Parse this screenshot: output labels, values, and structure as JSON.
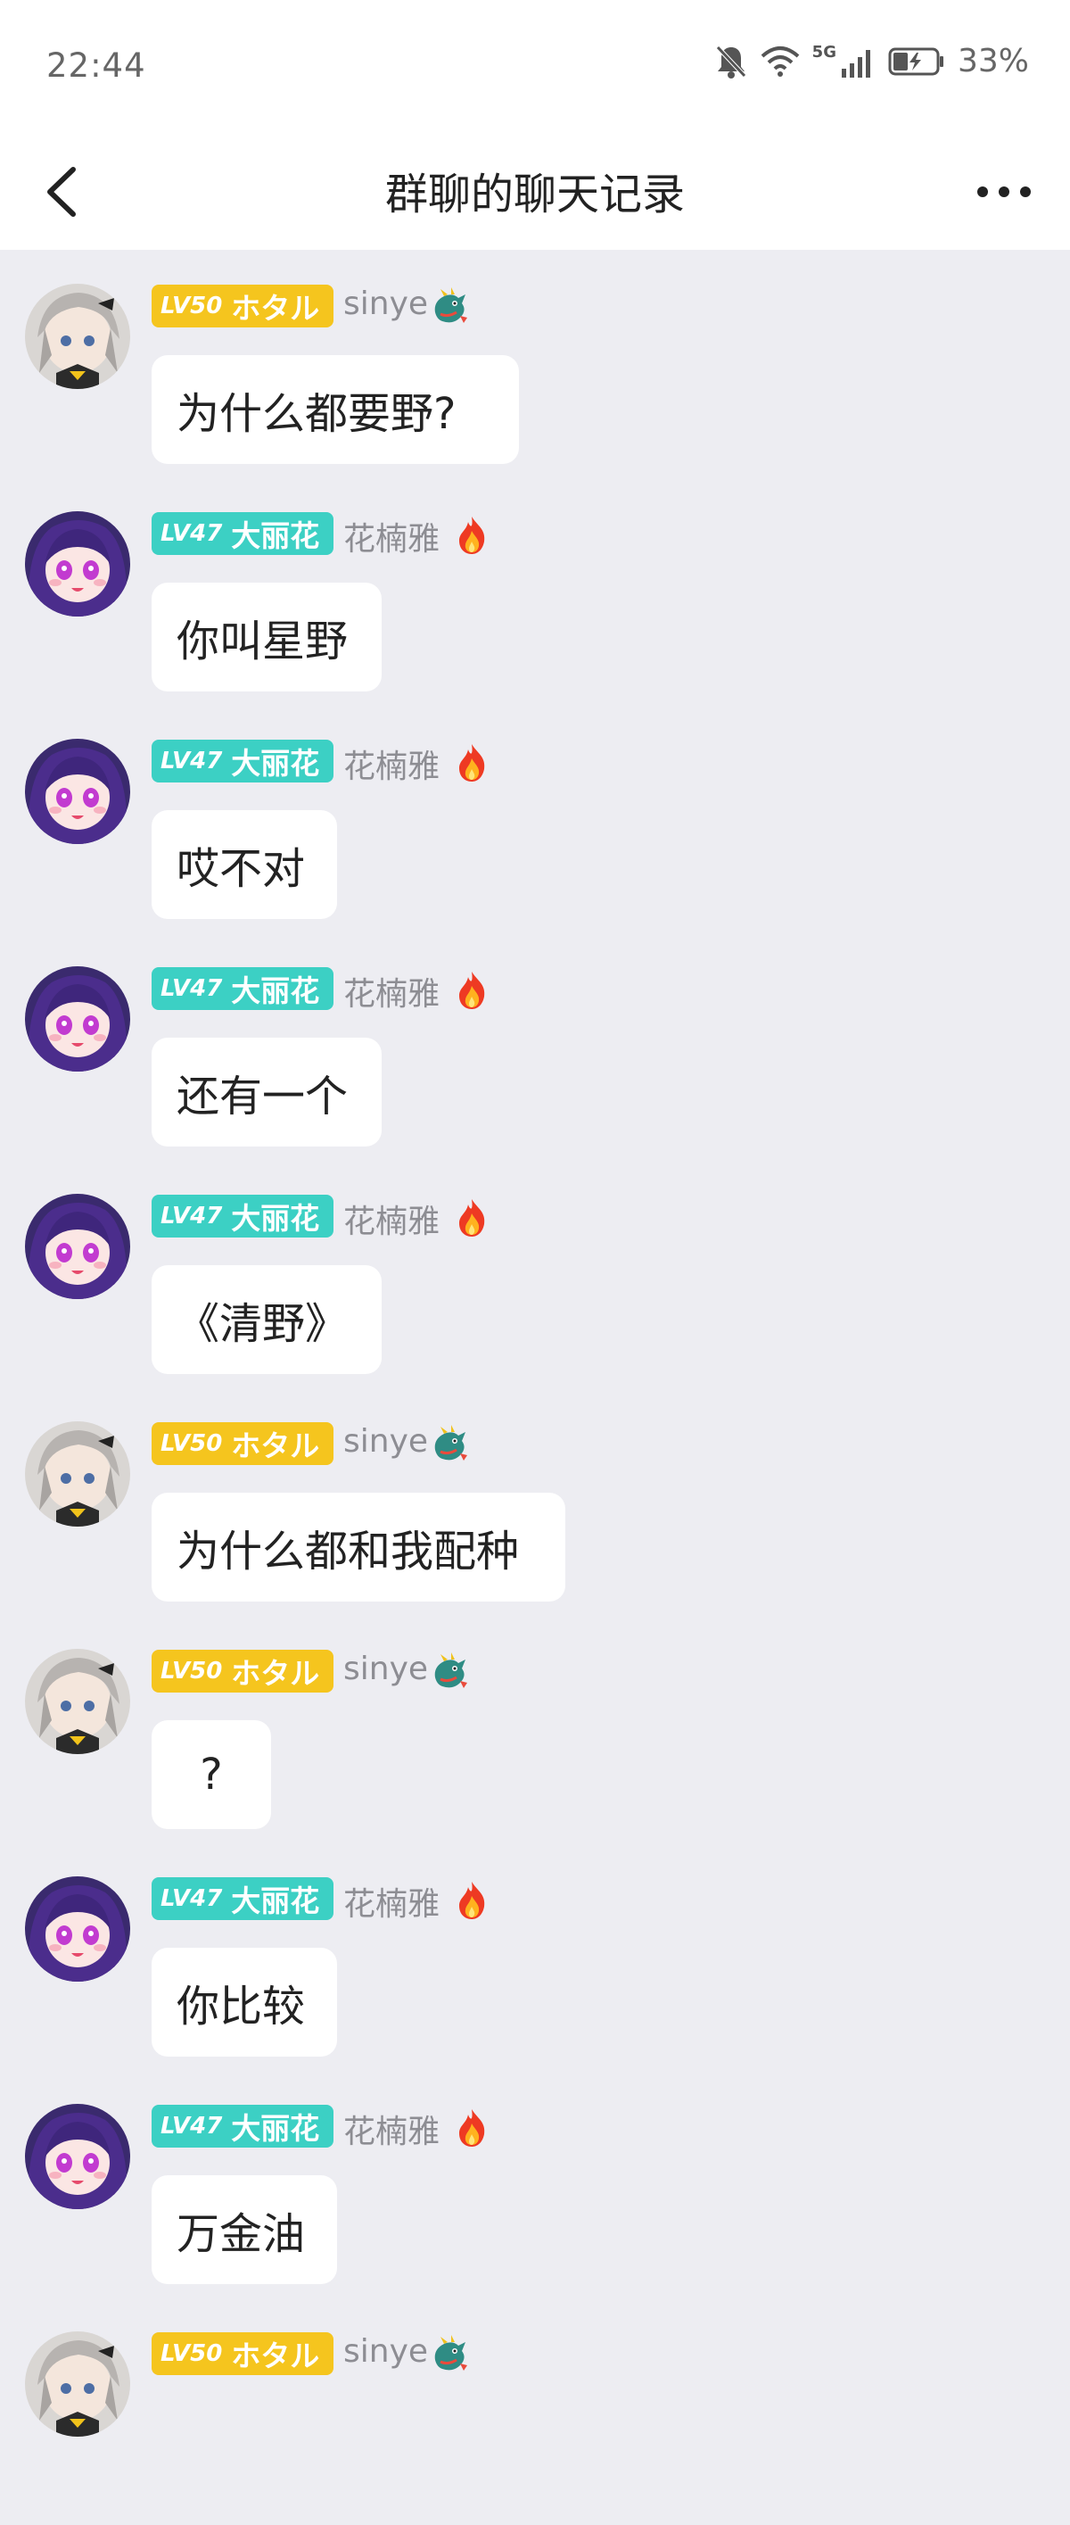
{
  "status_bar": {
    "time": "22:44",
    "network": "5G",
    "battery": "33%"
  },
  "header": {
    "title": "群聊的聊天记录"
  },
  "colors": {
    "gold_badge": "#f5c51e",
    "teal_badge": "#3cd0c4",
    "background": "#ededf2"
  },
  "messages": [
    {
      "level": "LV50",
      "tag": "ホタル",
      "name": "sinye",
      "text": "为什么都要野?",
      "badge": "gold",
      "emoji": "dragon-icon"
    },
    {
      "level": "LV47",
      "tag": "大丽花",
      "name": "花楠雅",
      "text": "你叫星野",
      "badge": "teal",
      "emoji": "fire-icon"
    },
    {
      "level": "LV47",
      "tag": "大丽花",
      "name": "花楠雅",
      "text": "哎不对",
      "badge": "teal",
      "emoji": "fire-icon"
    },
    {
      "level": "LV47",
      "tag": "大丽花",
      "name": "花楠雅",
      "text": "还有一个",
      "badge": "teal",
      "emoji": "fire-icon"
    },
    {
      "level": "LV47",
      "tag": "大丽花",
      "name": "花楠雅",
      "text": "《清野》",
      "badge": "teal",
      "emoji": "fire-icon"
    },
    {
      "level": "LV50",
      "tag": "ホタル",
      "name": "sinye",
      "text": "为什么都和我配种",
      "badge": "gold",
      "emoji": "dragon-icon"
    },
    {
      "level": "LV50",
      "tag": "ホタル",
      "name": "sinye",
      "text": "?",
      "badge": "gold",
      "emoji": "dragon-icon"
    },
    {
      "level": "LV47",
      "tag": "大丽花",
      "name": "花楠雅",
      "text": "你比较",
      "badge": "teal",
      "emoji": "fire-icon"
    },
    {
      "level": "LV47",
      "tag": "大丽花",
      "name": "花楠雅",
      "text": "万金油",
      "badge": "teal",
      "emoji": "fire-icon"
    },
    {
      "level": "LV50",
      "tag": "ホタル",
      "name": "sinye",
      "text": "",
      "badge": "gold",
      "emoji": "dragon-icon"
    }
  ]
}
